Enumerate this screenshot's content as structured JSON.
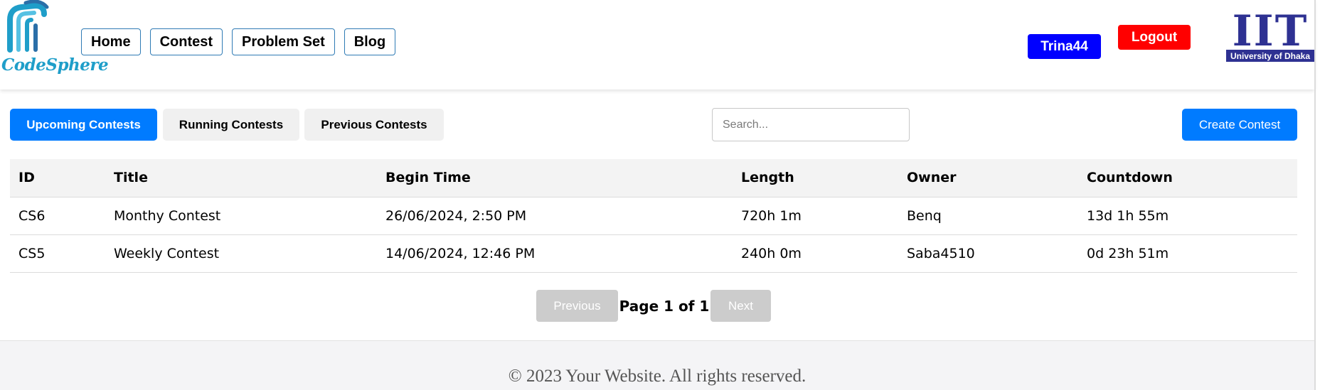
{
  "header": {
    "brand": "CodeSphere",
    "nav": [
      {
        "label": "Home"
      },
      {
        "label": "Contest"
      },
      {
        "label": "Problem Set"
      },
      {
        "label": "Blog"
      }
    ],
    "user_label": "Trina44",
    "logout_label": "Logout",
    "institution_logo": "IIT",
    "institution_name": "University of Dhaka"
  },
  "toolbar": {
    "tabs": [
      {
        "label": "Upcoming Contests",
        "active": true
      },
      {
        "label": "Running Contests",
        "active": false
      },
      {
        "label": "Previous Contests",
        "active": false
      }
    ],
    "search_placeholder": "Search...",
    "create_label": "Create Contest"
  },
  "table": {
    "columns": [
      "ID",
      "Title",
      "Begin Time",
      "Length",
      "Owner",
      "Countdown"
    ],
    "rows": [
      [
        "CS6",
        "Monthy Contest",
        "26/06/2024, 2:50 PM",
        "720h 1m",
        "Benq",
        "13d 1h 55m"
      ],
      [
        "CS5",
        "Weekly Contest",
        "14/06/2024, 12:46 PM",
        "240h 0m",
        "Saba4510",
        "0d 23h 51m"
      ]
    ]
  },
  "pagination": {
    "prev_label": "Previous",
    "info": "Page 1 of 1",
    "next_label": "Next"
  },
  "footer": {
    "text": "© 2023 Your Website. All rights reserved."
  },
  "colors": {
    "primary": "#007bff",
    "user_button": "#0000ff",
    "logout_button": "#ff0000",
    "brand": "#1f9ec9",
    "institution": "#2e3192",
    "disabled": "#cccccc"
  }
}
